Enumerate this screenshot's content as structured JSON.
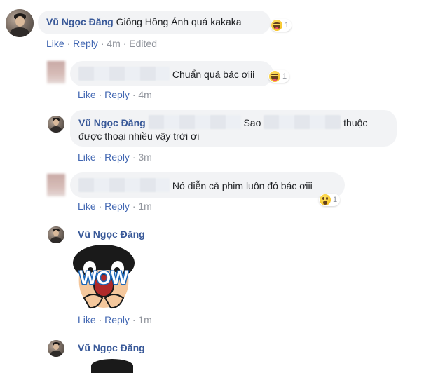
{
  "comments": [
    {
      "author": "Vũ Ngọc Đăng",
      "text": "Giống Hồng Ánh quá kakaka",
      "reaction": {
        "type": "haha",
        "count": "1"
      },
      "actions": {
        "like": "Like",
        "reply": "Reply",
        "time": "4m",
        "edited": "Edited"
      }
    },
    {
      "text": "Chuẩn quá bác ơiii",
      "reaction": {
        "type": "haha",
        "count": "1"
      },
      "actions": {
        "like": "Like",
        "reply": "Reply",
        "time": "4m"
      }
    },
    {
      "author": "Vũ Ngọc Đăng",
      "text_1": "Sao",
      "text_2": "thuộc",
      "text_3": "được thoại nhiều vậy trời ơi",
      "actions": {
        "like": "Like",
        "reply": "Reply",
        "time": "3m"
      }
    },
    {
      "text": "Nó diễn cả phim luôn đó bác ơiii",
      "reaction": {
        "type": "wow",
        "count": "1"
      },
      "actions": {
        "like": "Like",
        "reply": "Reply",
        "time": "1m"
      }
    },
    {
      "author": "Vũ Ngọc Đăng",
      "sticker_text": "WOW",
      "actions": {
        "like": "Like",
        "reply": "Reply",
        "time": "1m"
      }
    },
    {
      "author": "Vũ Ngọc Đăng"
    }
  ],
  "separator": "·",
  "colors": {
    "author": "#385898",
    "link": "#4267b2",
    "meta": "#90949c",
    "bubble": "#f2f3f5"
  },
  "icons": {
    "haha": "haha-reaction-icon",
    "wow": "wow-reaction-icon"
  }
}
